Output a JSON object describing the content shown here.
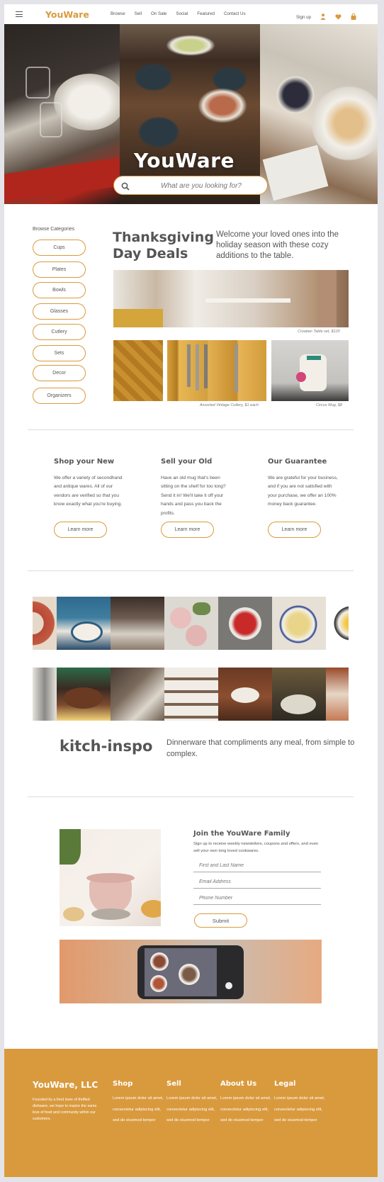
{
  "brand": {
    "name": "YouWare",
    "accent": "#d99a3e"
  },
  "nav": {
    "links": [
      "Browse",
      "Sell",
      "On Sale",
      "Social",
      "Featured",
      "Contact Us"
    ],
    "signup": "Sign up",
    "icons": [
      "user-icon",
      "heart-icon",
      "bag-icon"
    ]
  },
  "hero": {
    "title": "YouWare",
    "search_placeholder": "What are you looking for?"
  },
  "categories": {
    "heading": "Browse Categories",
    "items": [
      "Cups",
      "Plates",
      "Bowls",
      "Glasses",
      "Cutlery",
      "Sets",
      "Decor",
      "Organizers"
    ]
  },
  "deals": {
    "title": "Thanksgiving Day Deals",
    "description": "Welcome your loved ones into the holiday season with these cozy additions to the table.",
    "captions": {
      "table": "Croatian Table set, $120",
      "cutlery": "Assorted Vintage Cutlery, $1 each",
      "mug": "Circus Mug, $8"
    }
  },
  "info": [
    {
      "title": "Shop your New",
      "text": "We offer a variety of secondhand and antique wares. All of our vendors are verified so that you know exactly what you're buying.",
      "button": "Learn more"
    },
    {
      "title": "Sell your Old",
      "text": "Have an old mug that's been sitting on the shelf for too long? Send it in! We'll take it off your hands and pass you back the profits.",
      "button": "Learn more"
    },
    {
      "title": "Our Guarantee",
      "text": "We are grateful for your business, and if you are not satisfied with your purchase, we offer an 100% money back guarantee.",
      "button": "Learn more"
    }
  ],
  "inspo": {
    "title": "kitch-inspo",
    "description": "Dinnerware that compliments any meal, from simple to complex."
  },
  "join": {
    "title": "Join the YouWare Family",
    "description": "Sign up to receive weekly newsletters, coupons and offers, and even sell your own long loved cookwares.",
    "fields": [
      "First and Last Name",
      "Email Address",
      "Phone Number"
    ],
    "submit": "Submit"
  },
  "footer": {
    "brand": "YouWare, LLC",
    "about": "Founded by a fond lover of thrifted dishware, we hope to inspire the same love of food and community within our customers.",
    "columns": [
      {
        "title": "Shop",
        "text": "Lorem ipsum dolor sit amet, consectetur adipiscing elit, sed do eiusmod tempor"
      },
      {
        "title": "Sell",
        "text": "Lorem ipsum dolor sit amet, consectetur adipiscing elit, sed do eiusmod tempor"
      },
      {
        "title": "About Us",
        "text": "Lorem ipsum dolor sit amet, consectetur adipiscing elit, sed do eiusmod tempor"
      },
      {
        "title": "Legal",
        "text": "Lorem ipsum dolor sit amet, consectetur adipiscing elit, sed do eiusmod tempor"
      }
    ]
  }
}
